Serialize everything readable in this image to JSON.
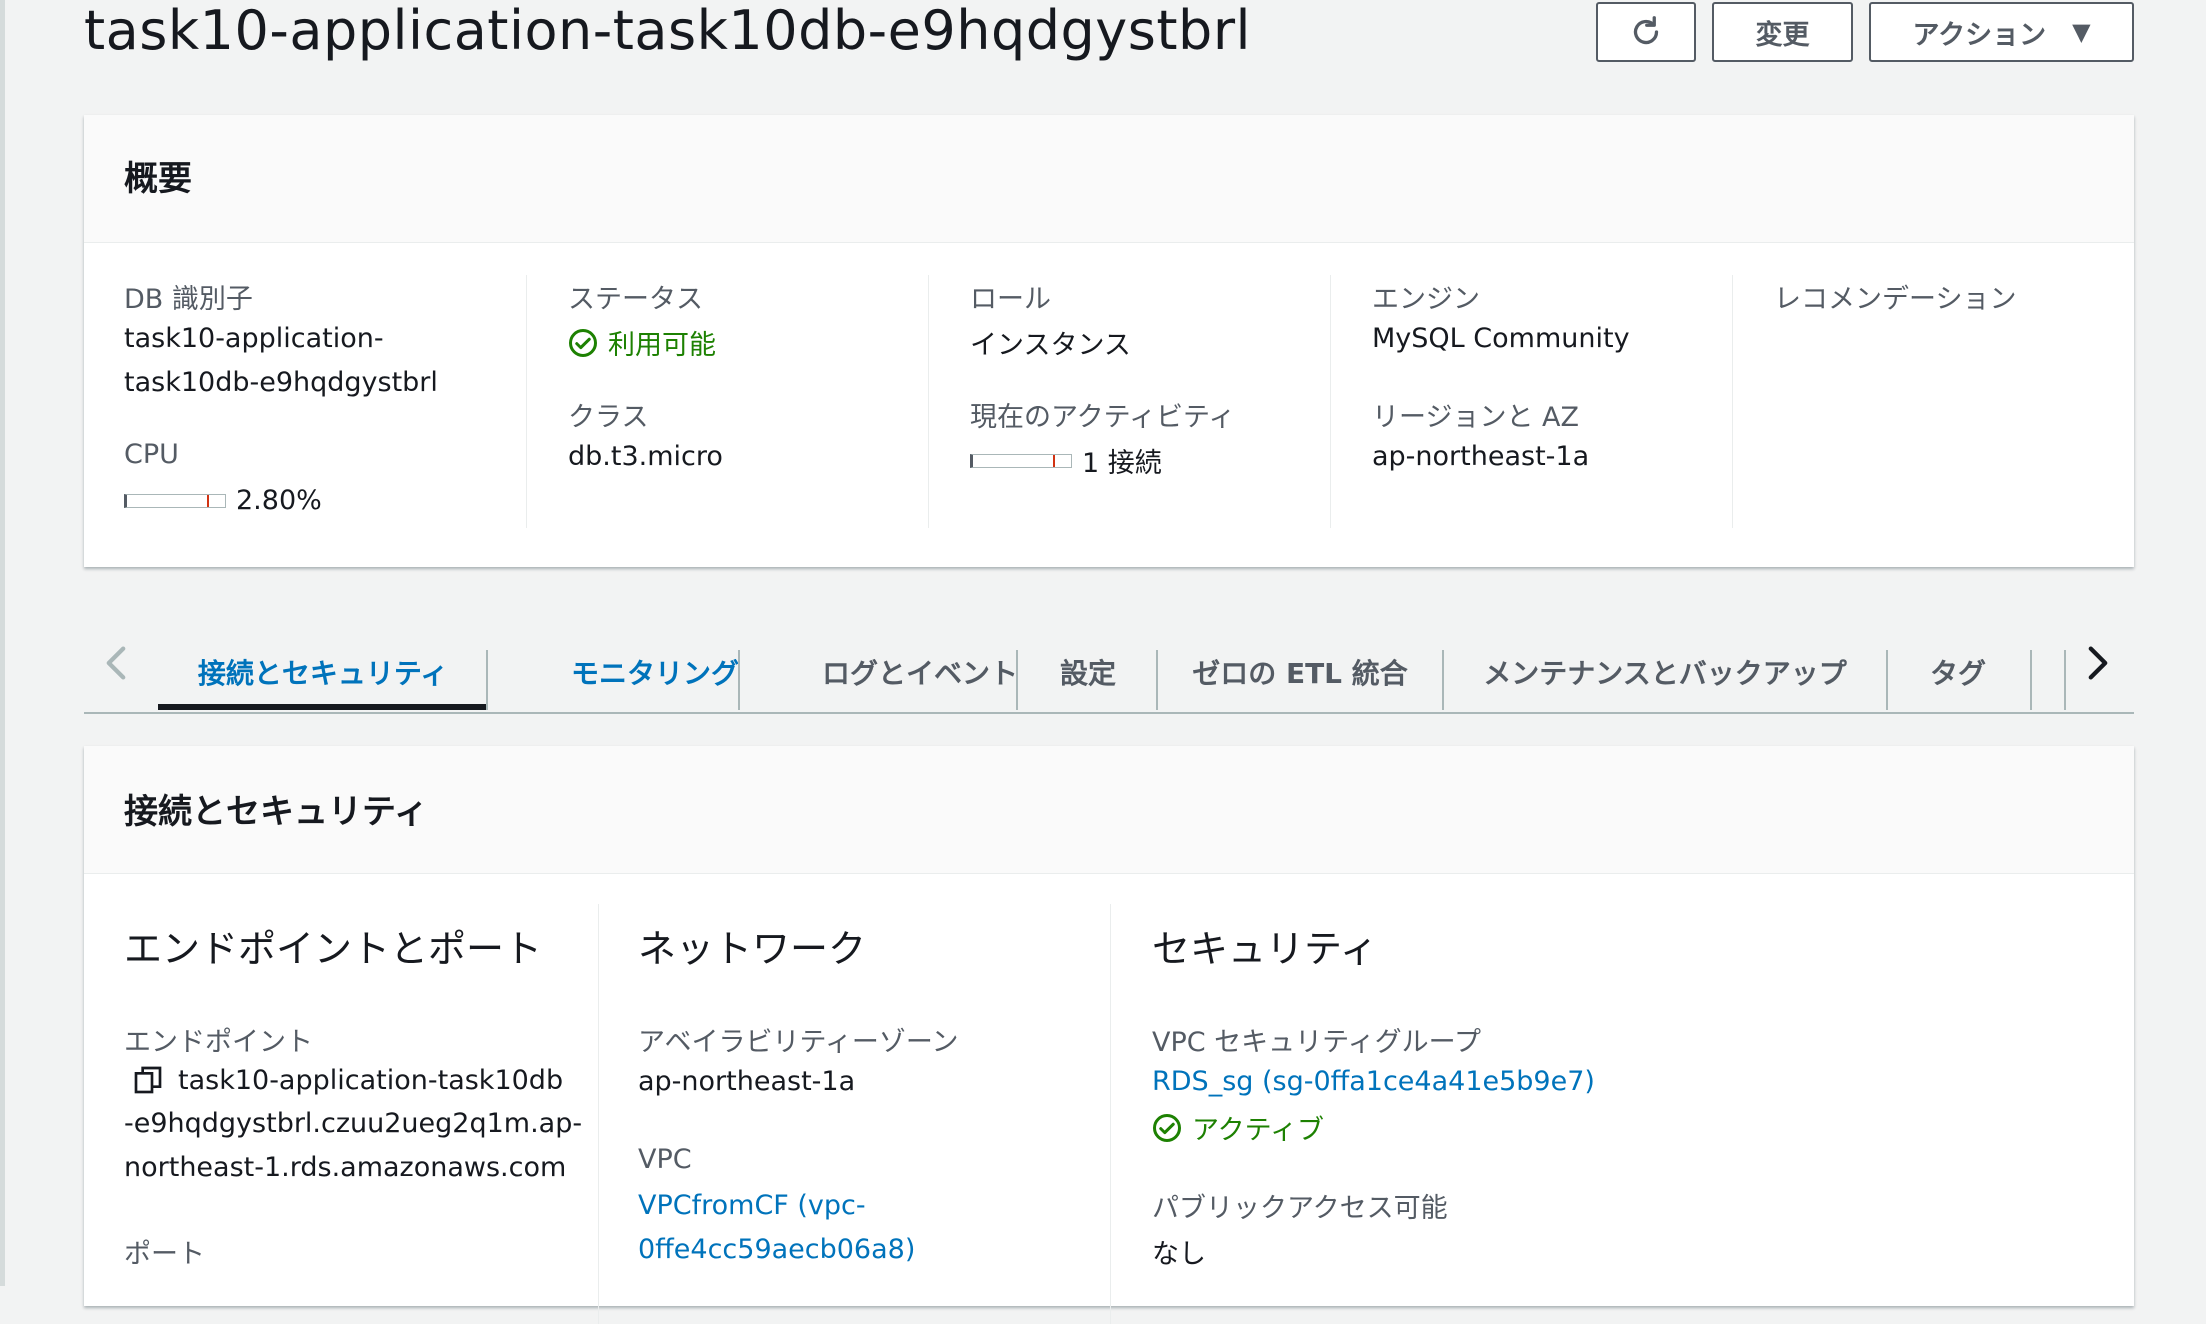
{
  "header": {
    "title": "task10-application-task10db-e9hqdgystbrl",
    "refresh_icon": "refresh-icon",
    "modify_label": "変更",
    "action_label": "アクション",
    "action_caret": "▼"
  },
  "overview": {
    "title": "概要",
    "db_id_label": "DB 識別子",
    "db_id_line1": "task10-application-",
    "db_id_line2": "task10db-e9hqdgystbrl",
    "cpu_label": "CPU",
    "cpu_value": "2.80%",
    "cpu_fraction": 0.028,
    "status_label": "ステータス",
    "status_value": "利用可能",
    "class_label": "クラス",
    "class_value": "db.t3.micro",
    "role_label": "ロール",
    "role_value": "インスタンス",
    "activity_label": "現在のアクティビティ",
    "activity_value": "1 接続",
    "engine_label": "エンジン",
    "engine_value": "MySQL Community",
    "region_label": "リージョンと AZ",
    "region_value": "ap-northeast-1a",
    "recommend_label": "レコメンデーション",
    "success_color": "#1d8102"
  },
  "tabs": {
    "items": [
      {
        "label": "接続とセキュリティ"
      },
      {
        "label": "モニタリング"
      },
      {
        "label": "ログとイベント"
      },
      {
        "label": "設定"
      },
      {
        "label": "ゼロの ETL 統合"
      },
      {
        "label": "メンテナンスとバックアップ"
      },
      {
        "label": "タグ"
      }
    ],
    "active_index": 0
  },
  "connectivity": {
    "title": "接続とセキュリティ",
    "endpoint_section": "エンドポイントとポート",
    "endpoint_label": "エンドポイント",
    "endpoint_line1": "task10-application-task10db",
    "endpoint_line2": "-e9hqdgystbrl.czuu2ueg2q1m.ap-",
    "endpoint_line3": "northeast-1.rds.amazonaws.com",
    "port_label": "ポート",
    "network_section": "ネットワーク",
    "az_label": "アベイラビリティーゾーン",
    "az_value": "ap-northeast-1a",
    "vpc_label": "VPC",
    "vpc_line1": "VPCfromCF (vpc-",
    "vpc_line2": "0ffe4cc59aecb06a8)",
    "security_section": "セキュリティ",
    "sg_label": "VPC セキュリティグループ",
    "sg_value": "RDS_sg (sg-0ffa1ce4a41e5b9e7)",
    "sg_status": "アクティブ",
    "public_label": "パブリックアクセス可能",
    "public_value": "なし"
  },
  "colors": {
    "link": "#0073bb",
    "text": "#16191f",
    "secondary": "#545b64",
    "background": "#f2f3f3"
  }
}
